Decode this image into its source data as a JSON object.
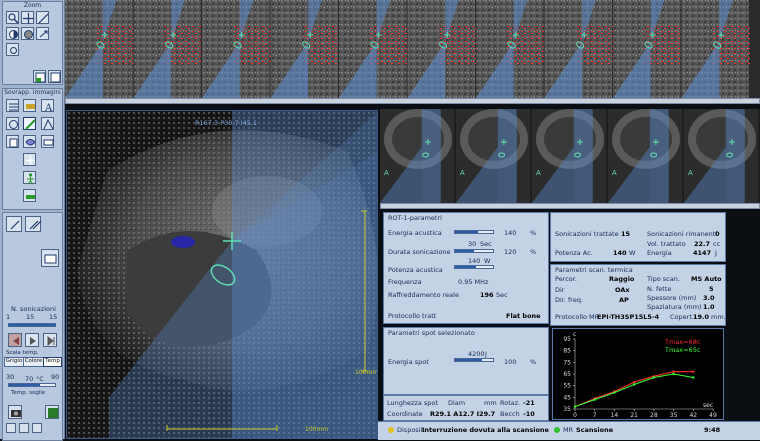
{
  "toolbar": {
    "zoom_group_title": "Zoom",
    "overlay_group_title": "Sovrapp. immagini",
    "sonication_label": "N. sonicazioni",
    "son_min": "1",
    "son_current": "15",
    "son_max": "15",
    "scale_label": "Scala temp.",
    "scale_buttons": [
      "Grigio",
      "Colore",
      "Temp"
    ],
    "temp_min": "30",
    "temp_value": "70",
    "temp_unit": "°C",
    "temp_max": "90",
    "threshold_label": "Temp. soglie"
  },
  "main_view": {
    "coords": "R167.3 P30.7 I45.1",
    "scale_right": "100mm",
    "scale_bottom": "100mm"
  },
  "rot_panel": {
    "title": "ROT-1-parametri",
    "acoustic_energy_label": "Energia acustica",
    "acoustic_energy_pct": "140",
    "duration_label": "Durata sonicazione",
    "duration_value": "30",
    "duration_unit": "Sec",
    "duration_pct": "120",
    "power_label": "Potenza acustica",
    "power_value": "140",
    "power_unit": "W",
    "frequency_label": "Frequenza",
    "frequency_value": "0.95 MHz",
    "cooling_label": "Raffreddamento reale",
    "cooling_value": "196",
    "cooling_unit": "Sec",
    "protocol_label": "Protocollo tratt",
    "protocol_value": "Flat bone",
    "percent_sign": "%"
  },
  "spot_panel": {
    "title": "Parametri spot selezionato",
    "energy_label": "Energia spot",
    "energy_value": "4200",
    "energy_unit": "J",
    "energy_pct": "100",
    "percent_sign": "%"
  },
  "summary": {
    "treated_label": "Sonicazioni trattate",
    "treated_value": "15",
    "remaining_label": "Sonicazioni rimanenti",
    "remaining_value": "0",
    "volume_label": "Vol. trattato",
    "volume_value": "22.7",
    "volume_unit": "cc",
    "power_label": "Potenza Ac.",
    "power_value": "140",
    "power_unit": "W",
    "energy_label": "Energia",
    "energy_value": "4147",
    "energy_unit": "J"
  },
  "thermal_panel": {
    "title": "Parametri scan. termica",
    "path_label": "Percor.",
    "path_value": "Raggio",
    "dir_label": "Dir",
    "dir_value": "OAx",
    "freq_dir_label": "Dir. freq.",
    "freq_dir_value": "AP",
    "scan_type_label": "Tipo scan.",
    "scan_type_value": "MS Auto",
    "slices_label": "N. fette",
    "slices_value": "5",
    "thickness_label": "Spessore (mm)",
    "thickness_value": "3.0",
    "spacing_label": "Spaziatura (mm)",
    "spacing_value": "1.0",
    "protocol_label": "Protocollo MR",
    "protocol_value": "EPI-TH3SP15L5-4",
    "coverage_label": "Copert.",
    "coverage_value": "19.0",
    "coverage_unit": "mm."
  },
  "bottom_info": {
    "spot_length_label": "Lunghezza spot",
    "diam_label": "Diam",
    "mm_label": "mm",
    "rotation_label": "Rotaz.",
    "rotation_value": "-21",
    "coords_label": "Coordinate",
    "coords_value": "R29.1 A12.7 I29.7",
    "tilt_label": "Becch",
    "tilt_value": "-10"
  },
  "status": {
    "device_label": "Disposit.",
    "device_message": "Interruzione dovuta alla scansione",
    "mr_label": "MR",
    "mr_status": "Scansione",
    "time": "9:48"
  },
  "chart_data": {
    "type": "line",
    "ylabel": "c",
    "xlabel": "sec",
    "x_ticks": [
      "0",
      "7",
      "14",
      "21",
      "28",
      "35",
      "42",
      "49"
    ],
    "y_ticks": [
      "35",
      "45",
      "55",
      "65",
      "75",
      "85",
      "95"
    ],
    "xlim": [
      0,
      49
    ],
    "ylim": [
      35,
      95
    ],
    "annotations": [
      "Tmax=68c",
      "Tmax=65c"
    ],
    "annotation_colors": [
      "#ff3030",
      "#33ff33"
    ],
    "series": [
      {
        "color": "#ff3030",
        "x": [
          0,
          7,
          14,
          21,
          28,
          35,
          42
        ],
        "y": [
          37,
          44,
          50,
          58,
          63,
          67,
          67
        ]
      },
      {
        "color": "#33ff33",
        "x": [
          0,
          7,
          14,
          21,
          28,
          35,
          42
        ],
        "y": [
          37,
          43,
          49,
          56,
          62,
          65,
          62
        ]
      }
    ]
  },
  "colors": {
    "panel_bg": "#c4d2e6",
    "toolbar_bg": "#9eb3cf",
    "overlay_blue": "#5b8fd6",
    "hot_red": "#e02020",
    "ellipse_green": "#5fe0b0"
  }
}
